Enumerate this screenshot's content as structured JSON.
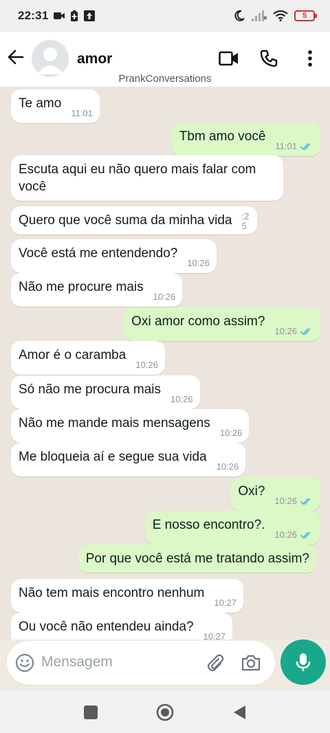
{
  "status_bar": {
    "time": "22:31",
    "battery": "5",
    "icons": [
      "video-camera-icon",
      "battery-saver-icon",
      "upload-icon",
      "moon-icon",
      "signal-icon",
      "wifi-icon",
      "battery-icon"
    ]
  },
  "header": {
    "contact_name": "amor",
    "watermark": "PrankConversations",
    "icons": [
      "back-arrow-icon",
      "avatar-placeholder",
      "video-call-icon",
      "phone-icon",
      "more-vert-icon"
    ]
  },
  "messages": [
    {
      "direction": "in",
      "text": "Te amo",
      "time": "11:01"
    },
    {
      "direction": "out",
      "text": "Tbm amo você",
      "time": "11:01",
      "read": true
    },
    {
      "direction": "in",
      "text": "Escuta aqui eu não quero mais falar com você",
      "time": ""
    },
    {
      "direction": "in",
      "text": "Quero que você suma da minha vida",
      "time": ":2 5"
    },
    {
      "direction": "in",
      "text": "Você está me entendendo?",
      "time": "10:26"
    },
    {
      "direction": "in",
      "text": "Não me procure mais",
      "time": "10:26"
    },
    {
      "direction": "out",
      "text": "Oxi amor como assim?",
      "time": "10:26",
      "read": true
    },
    {
      "direction": "in",
      "text": "Amor é o caramba",
      "time": "10:26"
    },
    {
      "direction": "in",
      "text": "Só não me procura mais",
      "time": "10:26"
    },
    {
      "direction": "in",
      "text": "Não me mande mais mensagens",
      "time": "10:26"
    },
    {
      "direction": "in",
      "text": "Me bloqueia aí e segue sua vida",
      "time": "10:26"
    },
    {
      "direction": "out",
      "text": "Oxi?",
      "time": "10:26",
      "read": true
    },
    {
      "direction": "out",
      "text": "E nosso encontro?.",
      "time": "10:26",
      "read": true
    },
    {
      "direction": "out",
      "text": "Por que você está me tratando assim?",
      "time": ""
    },
    {
      "direction": "in",
      "text": "Não tem mais encontro nenhum",
      "time": "10:27"
    },
    {
      "direction": "in",
      "text": "Ou você não entendeu ainda?",
      "time": "10:27"
    }
  ],
  "composer": {
    "placeholder": "Mensagem",
    "icons": [
      "emoji-icon",
      "attach-icon",
      "camera-icon",
      "mic-icon"
    ]
  },
  "nav_bar": {
    "icons": [
      "recents-icon",
      "home-icon",
      "back-icon"
    ]
  },
  "colors": {
    "incoming_bubble": "#ffffff",
    "outgoing_bubble": "#dcf8c6",
    "accent": "#1aa88b",
    "read_ticks": "#53bdeb"
  }
}
